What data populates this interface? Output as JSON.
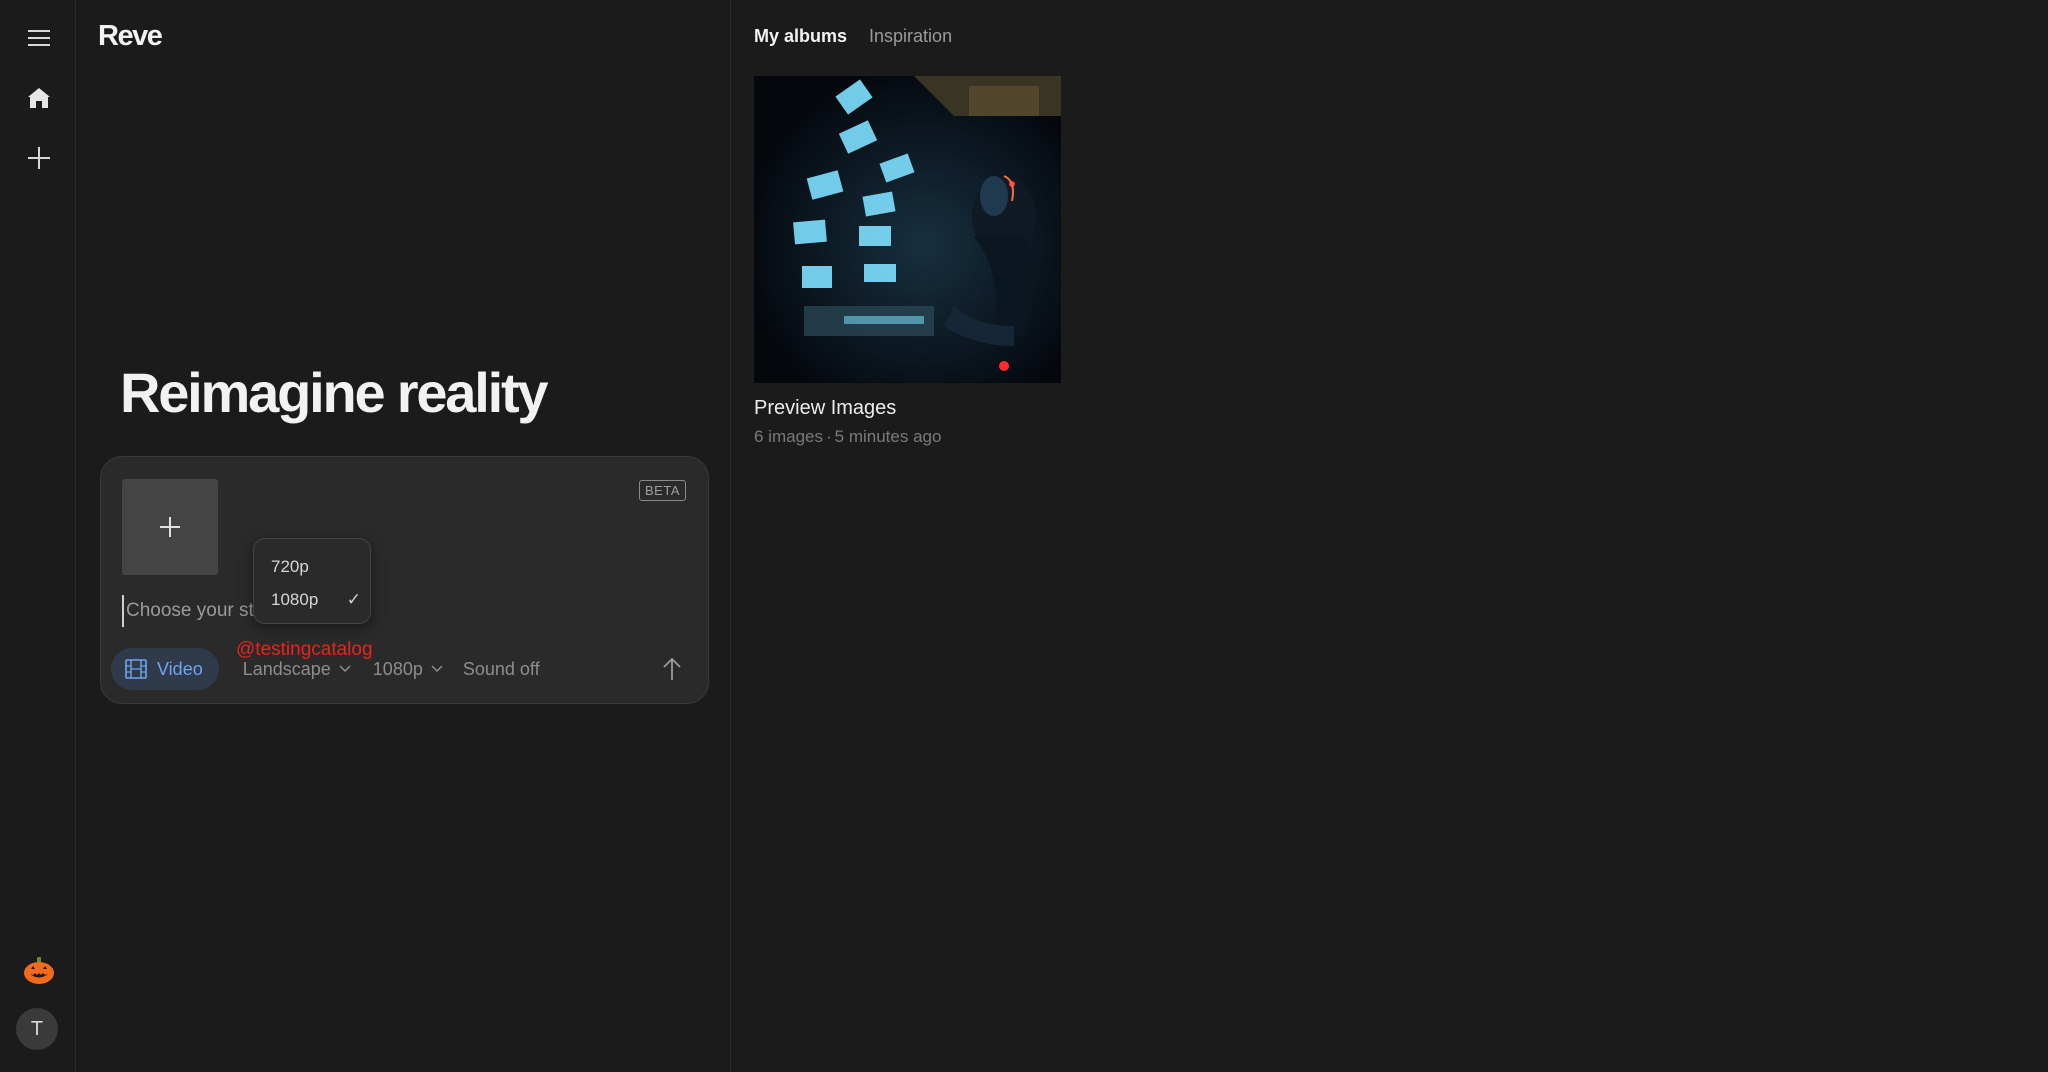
{
  "app": {
    "logo": "Reve"
  },
  "rail": {
    "icons": [
      "menu-icon",
      "home-icon",
      "plus-icon",
      "pumpkin-icon"
    ],
    "avatar_initial": "T"
  },
  "main": {
    "headline": "Reimagine reality",
    "composer": {
      "beta_badge": "BETA",
      "prompt_placeholder": "Choose your starting frame",
      "mode_label": "Video",
      "aspect_label": "Landscape",
      "resolution_label": "1080p",
      "sound_label": "Sound off",
      "watermark": "@testingcatalog"
    },
    "resolution_menu": {
      "options": [
        {
          "label": "720p",
          "selected": false
        },
        {
          "label": "1080p",
          "selected": true
        }
      ],
      "check_glyph": "✓"
    }
  },
  "right": {
    "tabs": [
      {
        "label": "My albums",
        "active": true
      },
      {
        "label": "Inspiration",
        "active": false
      }
    ],
    "albums": [
      {
        "title": "Preview Images",
        "count": "6 images",
        "separator": "·",
        "time": "5 minutes ago"
      }
    ]
  },
  "colors": {
    "background": "#1b1b1b",
    "accent_video": "#6fa6ef",
    "watermark": "#e8231d",
    "pumpkin": "#f26a1b"
  }
}
